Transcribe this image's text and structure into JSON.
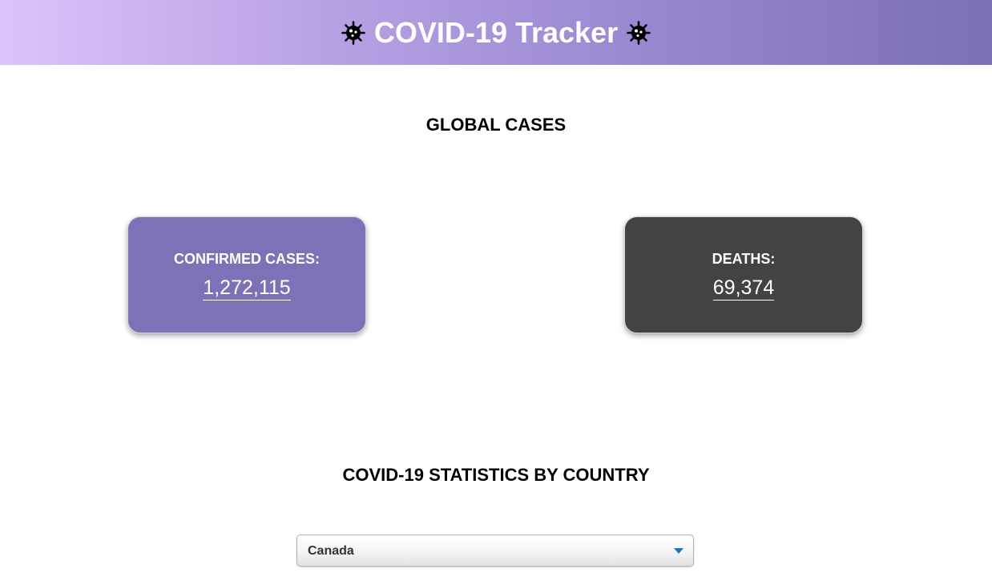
{
  "header": {
    "title": "COVID-19 Tracker",
    "left_icon": "virus-icon",
    "right_icon": "virus-icon"
  },
  "global": {
    "title": "GLOBAL CASES",
    "confirmed": {
      "label": "CONFIRMED CASES:",
      "value": "1,272,115",
      "color": "#7d71b7"
    },
    "deaths": {
      "label": "DEATHS:",
      "value": "69,374",
      "color": "#434343"
    }
  },
  "by_country": {
    "title": "COVID-19 STATISTICS BY COUNTRY",
    "selected_country": "Canada",
    "dropdown_icon": "chevron-down-icon",
    "accent_color": "#1b76b8"
  }
}
